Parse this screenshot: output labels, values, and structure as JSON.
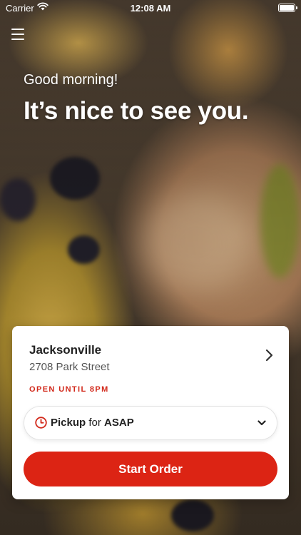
{
  "status_bar": {
    "carrier": "Carrier",
    "time": "12:08 AM"
  },
  "header": {
    "menu_icon": "hamburger-menu-icon",
    "greeting": "Good morning!",
    "headline": "It’s nice to see you."
  },
  "location": {
    "name": "Jacksonville",
    "address": "2708 Park Street",
    "hours": "OPEN UNTIL 8PM"
  },
  "order_mode": {
    "mode": "Pickup",
    "connector": "for",
    "time": "ASAP"
  },
  "actions": {
    "start_order": "Start Order"
  },
  "colors": {
    "accent": "#dc2414",
    "status_text": "#d2281a"
  }
}
